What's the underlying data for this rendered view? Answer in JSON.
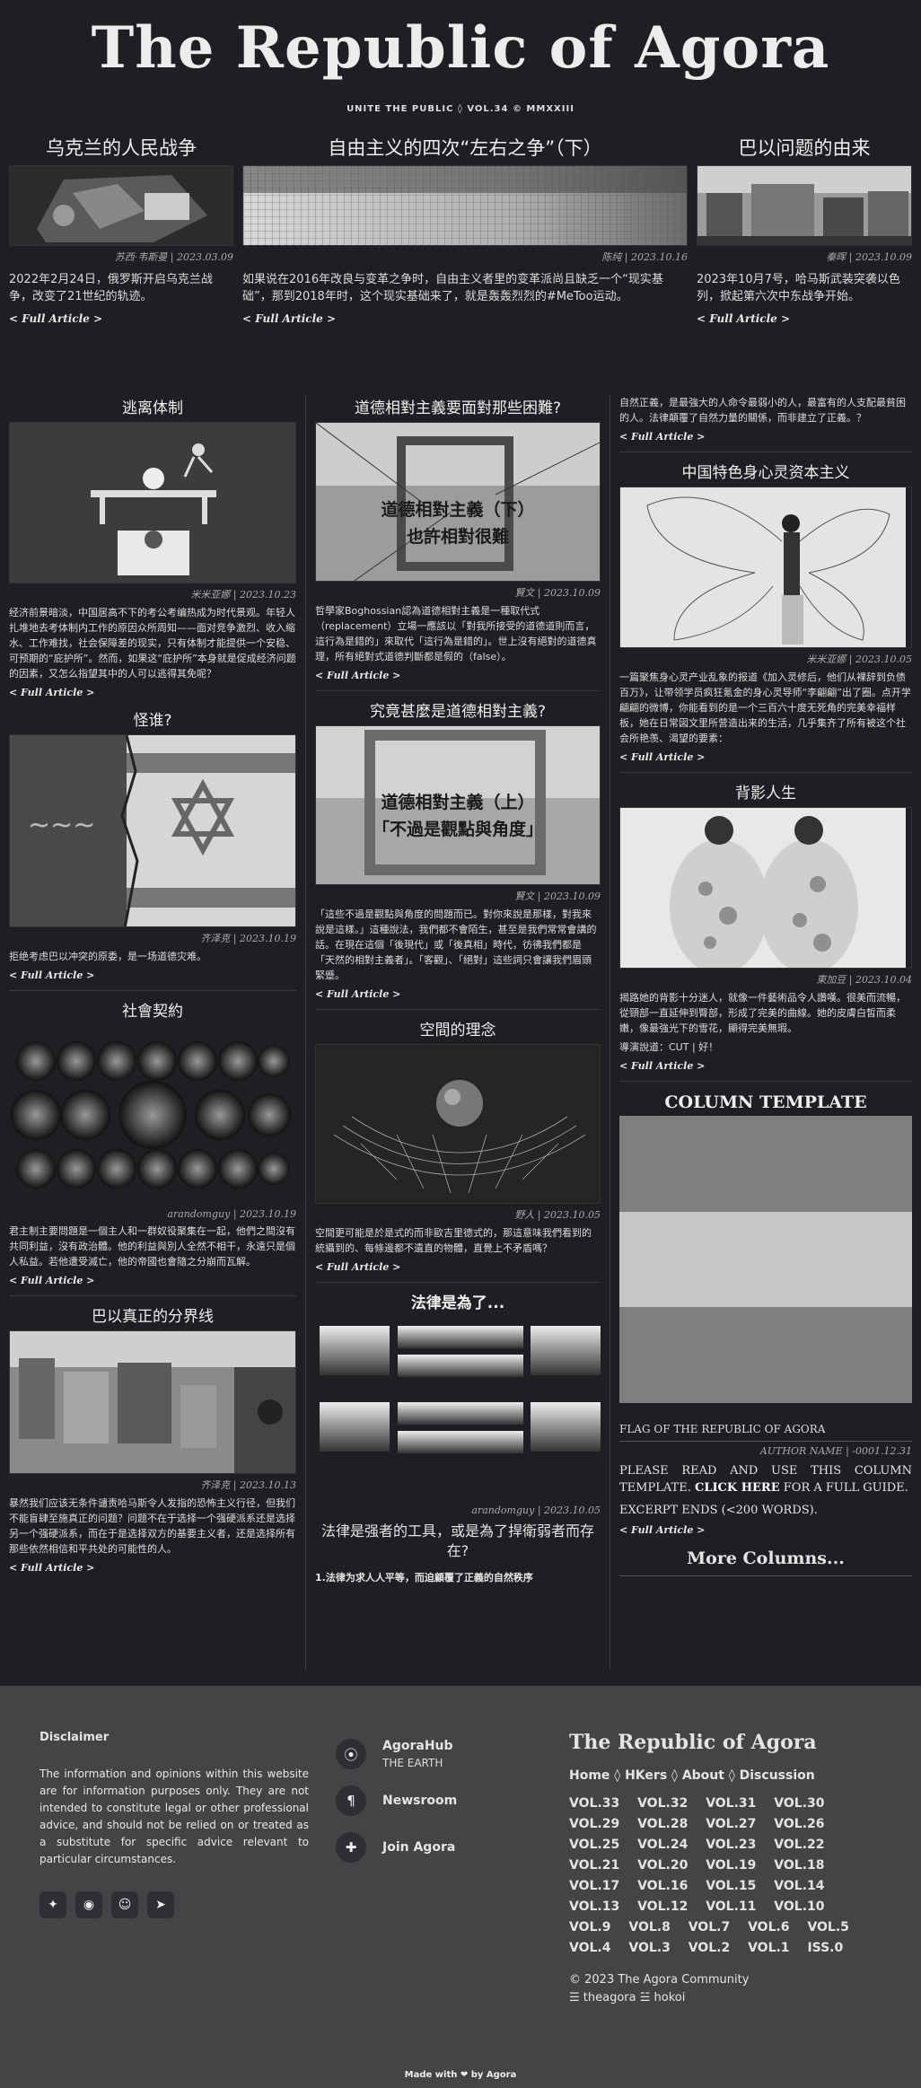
{
  "masthead": {
    "title": "The Republic of Agora",
    "subtitle": "UNITE THE PUBLIC ◊ VOL.34 © MMXXIII"
  },
  "top_articles": [
    {
      "title": "乌克兰的人民战争",
      "byline": "苏西·韦斯曼 | 2023.03.09",
      "excerpt": "2022年2月24日，俄罗斯开启乌克兰战争，改变了21世纪的轨迹。",
      "more": "< Full Article >"
    },
    {
      "title": "自由主义的四次“左右之争”（下）",
      "byline": "陈纯 | 2023.10.16",
      "excerpt": "如果说在2016年改良与变革之争时，自由主义者里的变革派尚且缺乏一个“现实基础”，那到2018年时，这个现实基础来了，就是轰轰烈烈的#MeToo运动。",
      "more": "< Full Article >"
    },
    {
      "title": "巴以问题的由来",
      "byline": "秦晖 | 2023.10.09",
      "excerpt": "2023年10月7号，哈马斯武装突袭以色列，掀起第六次中东战争开始。",
      "more": "< Full Article >"
    }
  ],
  "col1": [
    {
      "title": "逃离体制",
      "byline": "米米亚娜 | 2023.10.23",
      "text": "经济前景暗淡，中国居高不下的考公考编热成为时代景观。年轻人扎堆地去考体制内工作的原因众所周知——面对竞争激烈、收入缩水、工作难找，社会保障差的现实，只有体制才能提供一个安稳、可预期的“庇护所”。然而，如果这“庇护所”本身就是促成经济问题的因素，又怎么指望其中的人可以逃得其免呢？",
      "more": "< Full Article >"
    },
    {
      "title": "怪谁?",
      "byline": "齐泽克 | 2023.10.19",
      "text": "拒绝考虑巴以冲突的原委，是一场道德灾难。",
      "more": "< Full Article >"
    },
    {
      "title": "社會契約",
      "byline": "arandomguy | 2023.10.19",
      "text": "君主制主要問題是一個主人和一群奴役聚集在一起，他們之間沒有共同利益，沒有政治體。他的利益與別人全然不相干，永遠只是個人私益。若他遭受滅亡，他的帝國也會隨之分崩而瓦解。",
      "more": "< Full Article >"
    },
    {
      "title": "巴以真正的分界线",
      "byline": "齐泽克 | 2023.10.13",
      "text": "暴然我们应该无条件谴责哈马斯令人发指的恐怖主义行径，但我们不能盲肆至施真正的问题？问题不在于选择一个强硬派系还是选择另一个强硬派系，而在于是选择双方的基要主义者，还是选择所有那些依然相信和平共处的可能性的人。",
      "more": "< Full Article >"
    }
  ],
  "col2": [
    {
      "title": "道德相對主義要面對那些困難?",
      "overlay": "道德相對主義（下）\n也許相對很難",
      "byline": "賢文 | 2023.10.09",
      "text": "哲學家Boghossian認為道德相對主義是一種取代式（replacement）立場一應該以「對我所接受的道德道則而言，這行為是錯的」來取代「這行為是錯的」。世上沒有絕對的道德真理，所有絕對式道德判斷都是假的（false）。",
      "more": "< Full Article >"
    },
    {
      "title": "究竟甚麼是道德相對主義?",
      "overlay": "道德相對主義（上）\n「不過是觀點與角度」",
      "byline": "賢文 | 2023.10.09",
      "text": "「這些不過是觀點與角度的問題而已。對你來說是那樣，對我來說是這樣。」這種說法，我們都不會陌生，甚至是我們常常會講的話。在現在這個「後現代」或「後真相」時代，彷彿我們都是「天然的相對主義者」。「客觀」、「絕對」這些詞只會讓我們眉頭緊蹙。",
      "more": "< Full Article >"
    },
    {
      "title": "空間的理念",
      "byline": "野人 | 2023.10.05",
      "text": "空間更可能是於是式的而非歐吉里德式的，那這意味我們看到的統攝到的、每條邊都不遺直的物體，直覺上不矛盾嗎？",
      "more": "< Full Article >"
    },
    {
      "title": "法律是為了...",
      "byline": "arandomguy | 2023.10.05",
      "subtitle": "法律是强者的工具，或是為了捍衛弱者而存在?",
      "text": "1.法律为求人人平等，而迫顧覆了正義的自然秩序"
    }
  ],
  "col3": [
    {
      "lead": "自然正義，是最強大的人命令最弱小的人，最富有的人支配最貧困的人。法律顛覆了自然力量的關係，而非建立了正義。？",
      "more": "< Full Article >"
    },
    {
      "title": "中国特色身心灵资本主义",
      "byline": "米米亚娜 | 2023.10.05",
      "text": "一篇聚焦身心灵产业乱象的报道《加入灵修后，他们从裸辞到负债百万》，让带领学员疯狂氪金的身心灵导师“李翩翩”出了圈。点开学翩翩的微博，你能看到的是一个三百六十度无死角的完美幸福样板，她在日常図文里所营造出来的生活，几乎集齐了所有被这个社会所艳羡、渴望的要素：",
      "more": "< Full Article >"
    },
    {
      "title": "背影人生",
      "byline": "東加豆 | 2023.10.04",
      "text": "揭路她的背影十分迷人，就像一件藝術品令人讚嘆。很美而流暢，從頸部一直延伸到臀部，形成了完美的曲線。她的皮膚白皙而柔嫩，像最強光下的雪花，顯得完美無瑕。",
      "text2": "導演說道：CUT | 好！",
      "more": "< Full Article >"
    }
  ],
  "template": {
    "title": "COLUMN TEMPLATE",
    "caption": "FLAG OF THE REPUBLIC OF AGORA",
    "author": "AUTHOR NAME | -0001.12.31",
    "body_pre": "PLEASE READ AND USE THIS COLUMN TEMPLATE.",
    "body_link": "CLICK HERE",
    "body_post": "FOR A FULL GUIDE.",
    "body2": "EXCERPT ENDS (<200 WORDS).",
    "more": "< Full Article >",
    "more_columns": "More Columns..."
  },
  "footer": {
    "disclaimer_title": "Disclaimer",
    "disclaimer": "The information and opinions within this website are for information purposes only. They are not intended to constitute legal or other professional advice, and should not be relied on or treated as a substitute for specific advice relevant to particular circumstances.",
    "nav": [
      {
        "icon": "location-pin-icon",
        "glyph": "⦿",
        "label": "AgoraHub",
        "sub": "THE EARTH"
      },
      {
        "icon": "paragraph-icon",
        "glyph": "¶",
        "label": "Newsroom",
        "sub": ""
      },
      {
        "icon": "puzzle-icon",
        "glyph": "✚",
        "label": "Join Agora",
        "sub": ""
      }
    ],
    "brand": "The Republic of Agora",
    "links": [
      "Home",
      "HKers",
      "About",
      "Discussion"
    ],
    "volumes": [
      "VOL.33",
      "VOL.32",
      "VOL.31",
      "VOL.30",
      "VOL.29",
      "VOL.28",
      "VOL.27",
      "VOL.26",
      "VOL.25",
      "VOL.24",
      "VOL.23",
      "VOL.22",
      "VOL.21",
      "VOL.20",
      "VOL.19",
      "VOL.18",
      "VOL.17",
      "VOL.16",
      "VOL.15",
      "VOL.14",
      "VOL.13",
      "VOL.12",
      "VOL.11",
      "VOL.10",
      "VOL.9",
      "VOL.8",
      "VOL.7",
      "VOL.6",
      "VOL.5",
      "VOL.4",
      "VOL.3",
      "VOL.2",
      "VOL.1",
      "ISS.0"
    ],
    "copyright": "© 2023 The Agora Community",
    "credits": "☰ theagora ☱ hokoi",
    "made_with": "Made with ❤ by Agora"
  }
}
